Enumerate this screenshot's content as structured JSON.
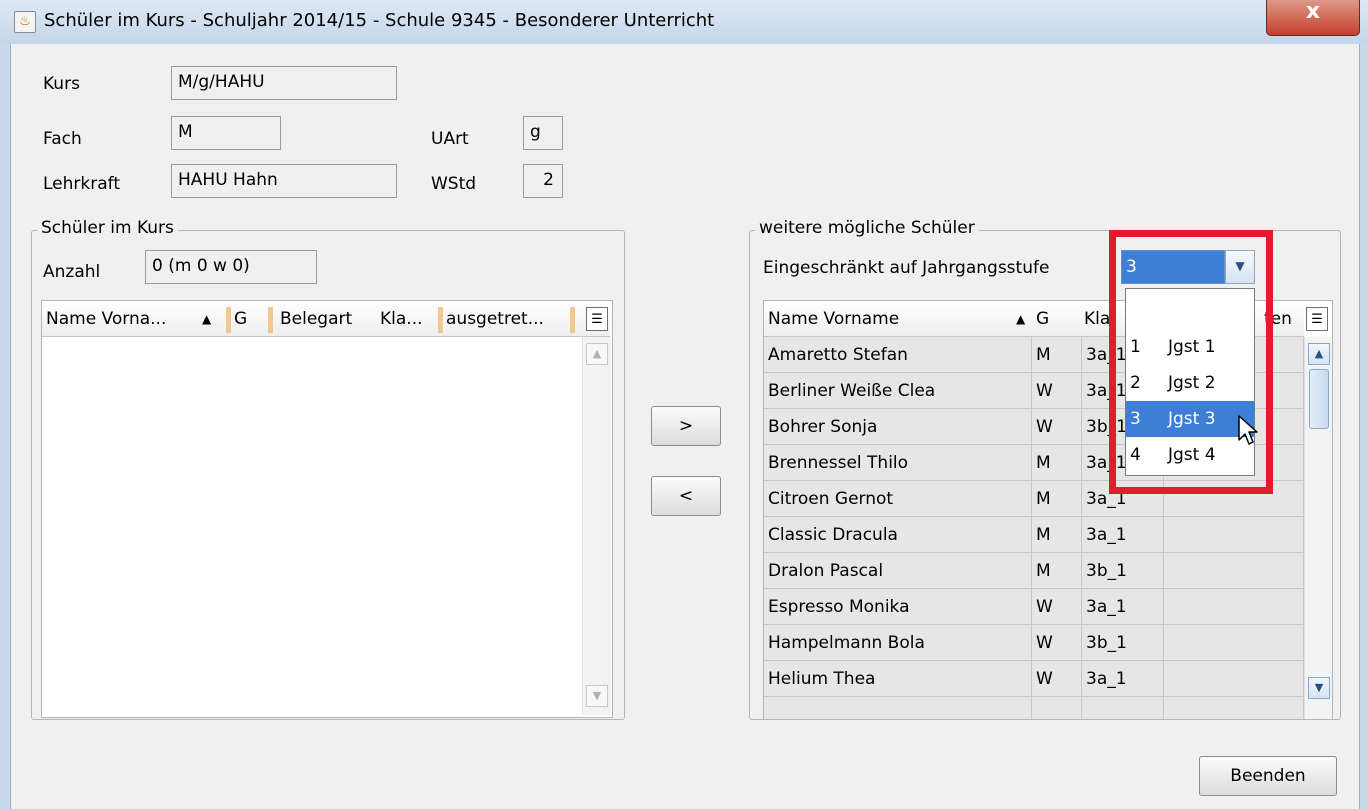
{
  "window": {
    "title": "Schüler im Kurs - Schuljahr 2014/15 - Schule 9345 - Besonderer Unterricht",
    "close_label": "x"
  },
  "form": {
    "kurs_label": "Kurs",
    "kurs_value": "M/g/HAHU",
    "fach_label": "Fach",
    "fach_value": "M",
    "uart_label": "UArt",
    "uart_value": "g",
    "lehrkraft_label": "Lehrkraft",
    "lehrkraft_value": "HAHU Hahn",
    "wstd_label": "WStd",
    "wstd_value": "2"
  },
  "left_group": {
    "title": "Schüler im Kurs",
    "anzahl_label": "Anzahl",
    "anzahl_value": "0 (m 0 w 0)",
    "columns": [
      "Name Vorna...",
      "G",
      "Belegart",
      "Kla...",
      "ausgetret..."
    ],
    "sort_indicator": "▲"
  },
  "move_buttons": {
    "add": ">",
    "remove": "<"
  },
  "right_group": {
    "title": "weitere mögliche Schüler",
    "filter_label": "Eingeschränkt auf Jahrgangsstufe",
    "filter_value": "3",
    "columns": [
      "Name Vorname",
      "G",
      "Kla",
      "ten"
    ],
    "sort_indicator": "▲",
    "rows": [
      {
        "name": "Amaretto Stefan",
        "g": "M",
        "klasse": "3a_1"
      },
      {
        "name": "Berliner Weiße Clea",
        "g": "W",
        "klasse": "3a_1"
      },
      {
        "name": "Bohrer Sonja",
        "g": "W",
        "klasse": "3b_1"
      },
      {
        "name": "Brennessel Thilo",
        "g": "M",
        "klasse": "3a_1"
      },
      {
        "name": "Citroen Gernot",
        "g": "M",
        "klasse": "3a_1"
      },
      {
        "name": "Classic Dracula",
        "g": "M",
        "klasse": "3a_1"
      },
      {
        "name": "Dralon Pascal",
        "g": "M",
        "klasse": "3b_1"
      },
      {
        "name": "Espresso Monika",
        "g": "W",
        "klasse": "3a_1"
      },
      {
        "name": "Hampelmann Bola",
        "g": "W",
        "klasse": "3b_1"
      },
      {
        "name": "Helium Thea",
        "g": "W",
        "klasse": "3a_1"
      }
    ]
  },
  "dropdown": {
    "options": [
      {
        "num": "",
        "text": ""
      },
      {
        "num": "1",
        "text": "Jgst 1"
      },
      {
        "num": "2",
        "text": "Jgst 2"
      },
      {
        "num": "3",
        "text": "Jgst 3"
      },
      {
        "num": "4",
        "text": "Jgst 4"
      }
    ],
    "selected_index": 3
  },
  "footer": {
    "close_button": "Beenden"
  },
  "colors": {
    "selection": "#3d7fd6",
    "highlight_box": "#e21c2a",
    "header_separator": "#f0c890"
  }
}
